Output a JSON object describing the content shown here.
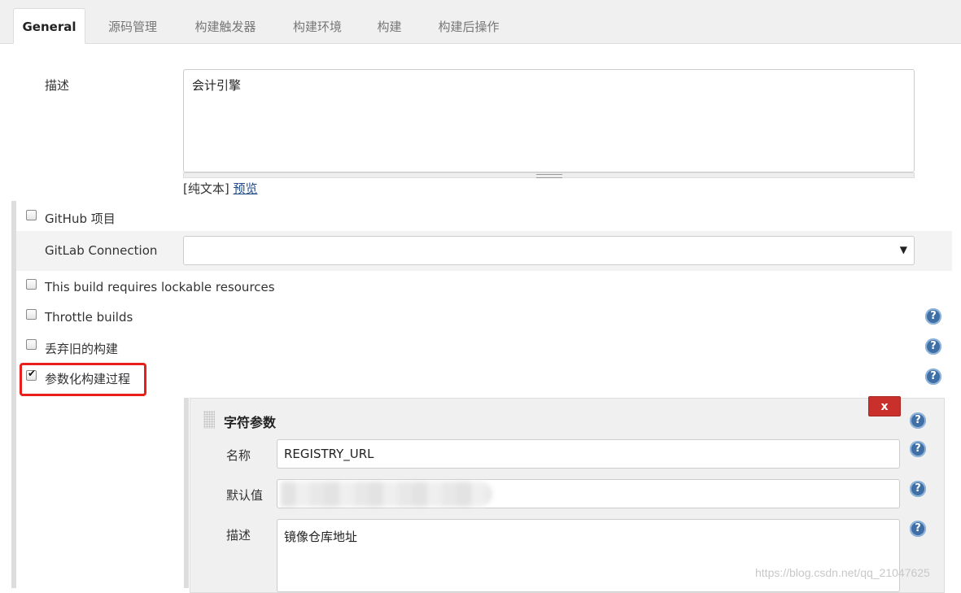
{
  "tabs": [
    {
      "label": "General",
      "active": true
    },
    {
      "label": "源码管理"
    },
    {
      "label": "构建触发器"
    },
    {
      "label": "构建环境"
    },
    {
      "label": "构建"
    },
    {
      "label": "构建后操作"
    }
  ],
  "description": {
    "label": "描述",
    "value": "会计引擎",
    "hint_prefix": "[纯文本]",
    "preview_link": "预览"
  },
  "options": {
    "github_project": {
      "label": "GitHub 项目",
      "checked": false
    },
    "gitlab_connection": {
      "label": "GitLab Connection",
      "value": ""
    },
    "lockable": {
      "label": "This build requires lockable resources",
      "checked": false
    },
    "throttle": {
      "label": "Throttle builds",
      "checked": false
    },
    "discard_old": {
      "label": "丢弃旧的构建",
      "checked": false
    },
    "parameterized": {
      "label": "参数化构建过程",
      "checked": true
    }
  },
  "string_param": {
    "title": "字符参数",
    "delete_label": "x",
    "name_label": "名称",
    "name_value": "REGISTRY_URL",
    "default_label": "默认值",
    "default_value": "",
    "desc_label": "描述",
    "desc_value": "镜像仓库地址"
  },
  "help_icon_glyph": "?",
  "watermark": "https://blog.csdn.net/qq_21047625",
  "colors": {
    "highlight": "#e8201c",
    "delete_button": "#c9302c",
    "help_icon": "#3f6fa5",
    "link": "#204a87"
  }
}
